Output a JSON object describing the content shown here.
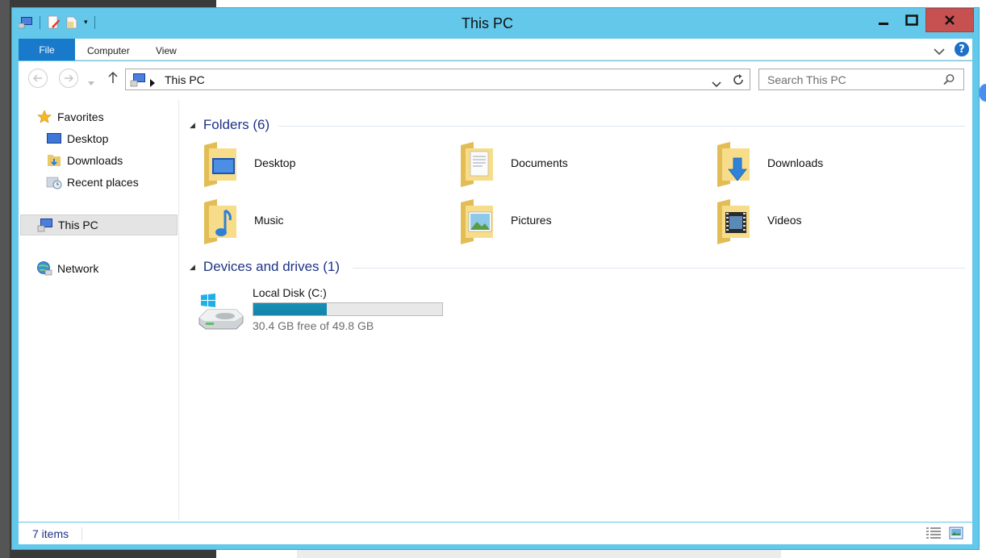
{
  "window": {
    "title": "This PC"
  },
  "ribbon": {
    "tabs": [
      "File",
      "Computer",
      "View"
    ]
  },
  "address": {
    "path": "This PC"
  },
  "search": {
    "placeholder": "Search This PC"
  },
  "nav_pane": {
    "favorites": "Favorites",
    "desktop": "Desktop",
    "downloads": "Downloads",
    "recent": "Recent places",
    "this_pc": "This PC",
    "network": "Network"
  },
  "folders": {
    "heading": "Folders (6)",
    "items": [
      "Desktop",
      "Documents",
      "Downloads",
      "Music",
      "Pictures",
      "Videos"
    ]
  },
  "devices": {
    "heading": "Devices and drives (1)",
    "drive": {
      "name": "Local Disk (C:)",
      "free_text": "30.4 GB free of 49.8 GB",
      "used_fraction": 0.39
    }
  },
  "status": {
    "count": "7 items"
  },
  "colors": {
    "title_bar": "#64c8ea",
    "file_tab": "#1979ca",
    "close_button": "#c75050",
    "drive_bar": "#168fb6"
  }
}
